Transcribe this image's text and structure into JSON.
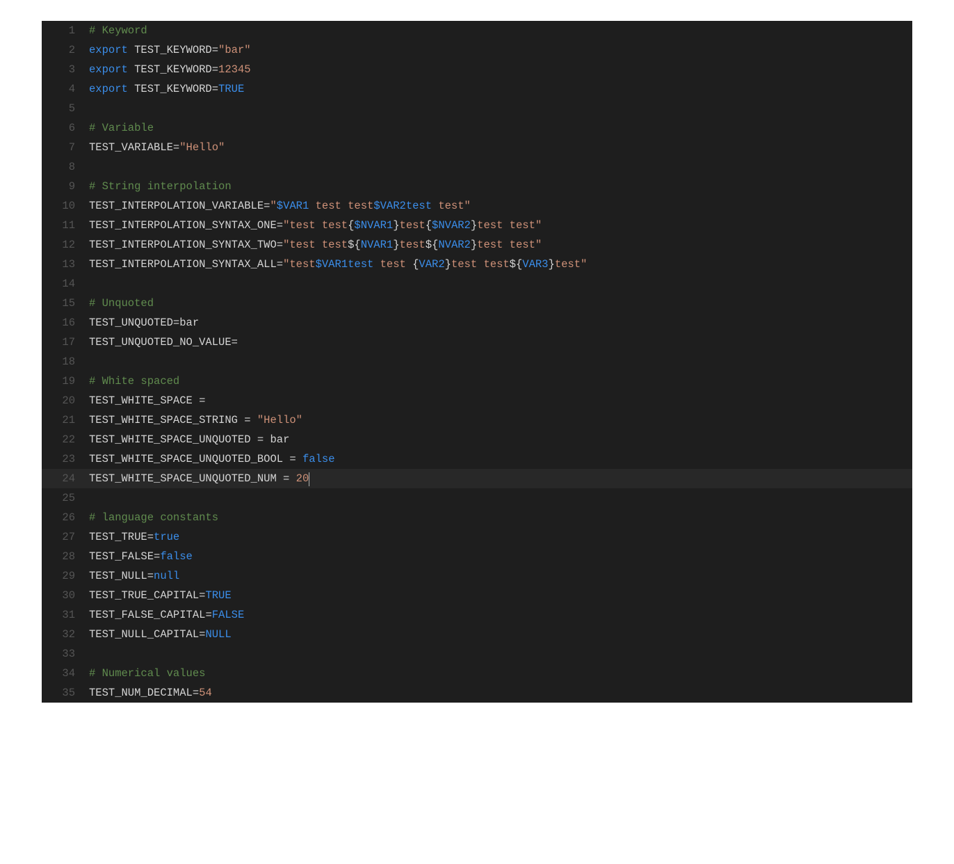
{
  "editor": {
    "cursorLine": 24,
    "cursorAfterLastToken": true,
    "lines": [
      {
        "n": 1,
        "tokens": [
          {
            "type": "comment",
            "text": "# Keyword"
          }
        ]
      },
      {
        "n": 2,
        "tokens": [
          {
            "type": "keyword",
            "text": "export"
          },
          {
            "type": "plain",
            "text": " TEST_KEYWORD"
          },
          {
            "type": "equals",
            "text": "="
          },
          {
            "type": "string",
            "text": "\"bar\""
          }
        ]
      },
      {
        "n": 3,
        "tokens": [
          {
            "type": "keyword",
            "text": "export"
          },
          {
            "type": "plain",
            "text": " TEST_KEYWORD"
          },
          {
            "type": "equals",
            "text": "="
          },
          {
            "type": "number",
            "text": "12345"
          }
        ]
      },
      {
        "n": 4,
        "tokens": [
          {
            "type": "keyword",
            "text": "export"
          },
          {
            "type": "plain",
            "text": " TEST_KEYWORD"
          },
          {
            "type": "equals",
            "text": "="
          },
          {
            "type": "bool",
            "text": "TRUE"
          }
        ]
      },
      {
        "n": 5,
        "tokens": []
      },
      {
        "n": 6,
        "tokens": [
          {
            "type": "comment",
            "text": "# Variable"
          }
        ]
      },
      {
        "n": 7,
        "tokens": [
          {
            "type": "plain",
            "text": "TEST_VARIABLE"
          },
          {
            "type": "equals",
            "text": "="
          },
          {
            "type": "string",
            "text": "\"Hello\""
          }
        ]
      },
      {
        "n": 8,
        "tokens": []
      },
      {
        "n": 9,
        "tokens": [
          {
            "type": "comment",
            "text": "# String interpolation"
          }
        ]
      },
      {
        "n": 10,
        "tokens": [
          {
            "type": "plain",
            "text": "TEST_INTERPOLATION_VARIABLE"
          },
          {
            "type": "equals",
            "text": "="
          },
          {
            "type": "string",
            "text": "\""
          },
          {
            "type": "var",
            "text": "$VAR1"
          },
          {
            "type": "string",
            "text": " test test"
          },
          {
            "type": "var",
            "text": "$VAR2test"
          },
          {
            "type": "string",
            "text": " test\""
          }
        ]
      },
      {
        "n": 11,
        "tokens": [
          {
            "type": "plain",
            "text": "TEST_INTERPOLATION_SYNTAX_ONE"
          },
          {
            "type": "equals",
            "text": "="
          },
          {
            "type": "string",
            "text": "\"test test"
          },
          {
            "type": "plain",
            "text": "{"
          },
          {
            "type": "var",
            "text": "$NVAR1"
          },
          {
            "type": "plain",
            "text": "}"
          },
          {
            "type": "string",
            "text": "test"
          },
          {
            "type": "plain",
            "text": "{"
          },
          {
            "type": "var",
            "text": "$NVAR2"
          },
          {
            "type": "plain",
            "text": "}"
          },
          {
            "type": "string",
            "text": "test test\""
          }
        ]
      },
      {
        "n": 12,
        "tokens": [
          {
            "type": "plain",
            "text": "TEST_INTERPOLATION_SYNTAX_TWO"
          },
          {
            "type": "equals",
            "text": "="
          },
          {
            "type": "string",
            "text": "\"test test"
          },
          {
            "type": "plain",
            "text": "${"
          },
          {
            "type": "var",
            "text": "NVAR1"
          },
          {
            "type": "plain",
            "text": "}"
          },
          {
            "type": "string",
            "text": "test"
          },
          {
            "type": "plain",
            "text": "${"
          },
          {
            "type": "var",
            "text": "NVAR2"
          },
          {
            "type": "plain",
            "text": "}"
          },
          {
            "type": "string",
            "text": "test test\""
          }
        ]
      },
      {
        "n": 13,
        "tokens": [
          {
            "type": "plain",
            "text": "TEST_INTERPOLATION_SYNTAX_ALL"
          },
          {
            "type": "equals",
            "text": "="
          },
          {
            "type": "string",
            "text": "\"test"
          },
          {
            "type": "var",
            "text": "$VAR1test"
          },
          {
            "type": "string",
            "text": " test "
          },
          {
            "type": "plain",
            "text": "{"
          },
          {
            "type": "var",
            "text": "VAR2"
          },
          {
            "type": "plain",
            "text": "}"
          },
          {
            "type": "string",
            "text": "test test"
          },
          {
            "type": "plain",
            "text": "${"
          },
          {
            "type": "var",
            "text": "VAR3"
          },
          {
            "type": "plain",
            "text": "}"
          },
          {
            "type": "string",
            "text": "test\""
          }
        ]
      },
      {
        "n": 14,
        "tokens": []
      },
      {
        "n": 15,
        "tokens": [
          {
            "type": "comment",
            "text": "# Unquoted"
          }
        ]
      },
      {
        "n": 16,
        "tokens": [
          {
            "type": "plain",
            "text": "TEST_UNQUOTED"
          },
          {
            "type": "equals",
            "text": "="
          },
          {
            "type": "ident",
            "text": "bar"
          }
        ]
      },
      {
        "n": 17,
        "tokens": [
          {
            "type": "plain",
            "text": "TEST_UNQUOTED_NO_VALUE"
          },
          {
            "type": "equals",
            "text": "="
          }
        ]
      },
      {
        "n": 18,
        "tokens": []
      },
      {
        "n": 19,
        "tokens": [
          {
            "type": "comment",
            "text": "# White spaced"
          }
        ]
      },
      {
        "n": 20,
        "tokens": [
          {
            "type": "plain",
            "text": "TEST_WHITE_SPACE "
          },
          {
            "type": "equals",
            "text": "="
          }
        ]
      },
      {
        "n": 21,
        "tokens": [
          {
            "type": "plain",
            "text": "TEST_WHITE_SPACE_STRING "
          },
          {
            "type": "equals",
            "text": "="
          },
          {
            "type": "plain",
            "text": " "
          },
          {
            "type": "string",
            "text": "\"Hello\""
          }
        ]
      },
      {
        "n": 22,
        "tokens": [
          {
            "type": "plain",
            "text": "TEST_WHITE_SPACE_UNQUOTED "
          },
          {
            "type": "equals",
            "text": "="
          },
          {
            "type": "plain",
            "text": " "
          },
          {
            "type": "ident",
            "text": "bar"
          }
        ]
      },
      {
        "n": 23,
        "tokens": [
          {
            "type": "plain",
            "text": "TEST_WHITE_SPACE_UNQUOTED_BOOL "
          },
          {
            "type": "equals",
            "text": "="
          },
          {
            "type": "plain",
            "text": " "
          },
          {
            "type": "bool",
            "text": "false"
          }
        ]
      },
      {
        "n": 24,
        "tokens": [
          {
            "type": "plain",
            "text": "TEST_WHITE_SPACE_UNQUOTED_NUM "
          },
          {
            "type": "equals",
            "text": "="
          },
          {
            "type": "plain",
            "text": " "
          },
          {
            "type": "number",
            "text": "20"
          }
        ]
      },
      {
        "n": 25,
        "tokens": []
      },
      {
        "n": 26,
        "tokens": [
          {
            "type": "comment",
            "text": "# language constants"
          }
        ]
      },
      {
        "n": 27,
        "tokens": [
          {
            "type": "plain",
            "text": "TEST_TRUE"
          },
          {
            "type": "equals",
            "text": "="
          },
          {
            "type": "bool",
            "text": "true"
          }
        ]
      },
      {
        "n": 28,
        "tokens": [
          {
            "type": "plain",
            "text": "TEST_FALSE"
          },
          {
            "type": "equals",
            "text": "="
          },
          {
            "type": "bool",
            "text": "false"
          }
        ]
      },
      {
        "n": 29,
        "tokens": [
          {
            "type": "plain",
            "text": "TEST_NULL"
          },
          {
            "type": "equals",
            "text": "="
          },
          {
            "type": "null",
            "text": "null"
          }
        ]
      },
      {
        "n": 30,
        "tokens": [
          {
            "type": "plain",
            "text": "TEST_TRUE_CAPITAL"
          },
          {
            "type": "equals",
            "text": "="
          },
          {
            "type": "bool",
            "text": "TRUE"
          }
        ]
      },
      {
        "n": 31,
        "tokens": [
          {
            "type": "plain",
            "text": "TEST_FALSE_CAPITAL"
          },
          {
            "type": "equals",
            "text": "="
          },
          {
            "type": "bool",
            "text": "FALSE"
          }
        ]
      },
      {
        "n": 32,
        "tokens": [
          {
            "type": "plain",
            "text": "TEST_NULL_CAPITAL"
          },
          {
            "type": "equals",
            "text": "="
          },
          {
            "type": "null",
            "text": "NULL"
          }
        ]
      },
      {
        "n": 33,
        "tokens": []
      },
      {
        "n": 34,
        "tokens": [
          {
            "type": "comment",
            "text": "# Numerical values"
          }
        ]
      },
      {
        "n": 35,
        "tokens": [
          {
            "type": "plain",
            "text": "TEST_NUM_DECIMAL"
          },
          {
            "type": "equals",
            "text": "="
          },
          {
            "type": "number",
            "text": "54"
          }
        ]
      }
    ]
  }
}
